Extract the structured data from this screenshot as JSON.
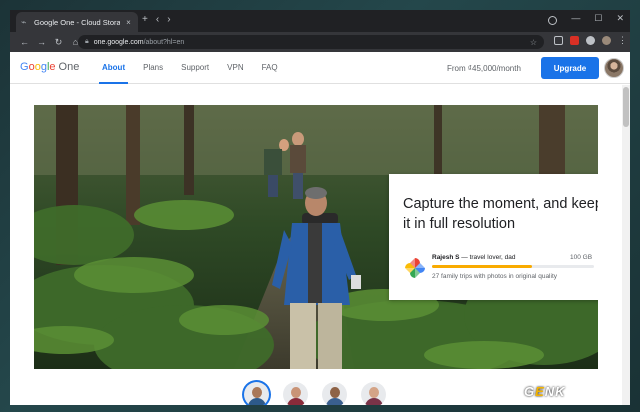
{
  "browser": {
    "tab_title": "Google One - Cloud Storage, Ac",
    "tab_close": "×",
    "new_tab": "+",
    "url_domain": "one.google.com",
    "url_path": "/about?hl=en"
  },
  "site": {
    "brand_google": [
      "G",
      "o",
      "o",
      "g",
      "l",
      "e"
    ],
    "brand_product": "One",
    "nav": [
      {
        "label": "About",
        "active": true
      },
      {
        "label": "Plans",
        "active": false
      },
      {
        "label": "Support",
        "active": false
      },
      {
        "label": "VPN",
        "active": false
      },
      {
        "label": "FAQ",
        "active": false
      }
    ],
    "price_text": "From ₫45,000/month",
    "upgrade_label": "Upgrade"
  },
  "hero_card": {
    "headline": "Capture the moment, and keep it in full resolution",
    "person_name": "Rajesh S",
    "person_desc": " — travel lover, dad",
    "storage": "100 GB",
    "storage_fill": 0.62,
    "caption": "27 family trips with photos in original quality"
  },
  "carousel": {
    "avatars": [
      {
        "name": "avatar-man-selected",
        "selected": true,
        "skin": "#a97858",
        "shirt": "#2d5a8a"
      },
      {
        "name": "avatar-woman-1",
        "selected": false,
        "skin": "#c99477",
        "shirt": "#8a2b3a"
      },
      {
        "name": "avatar-man-2",
        "selected": false,
        "skin": "#8e6347",
        "shirt": "#3a5f8f"
      },
      {
        "name": "avatar-woman-2",
        "selected": false,
        "skin": "#d4a487",
        "shirt": "#7a3348"
      }
    ]
  },
  "watermark": {
    "g": "G",
    "e": "E",
    "rest": "NK"
  },
  "colors": {
    "accent": "#1a73e8",
    "progress": "#f9ab00"
  }
}
